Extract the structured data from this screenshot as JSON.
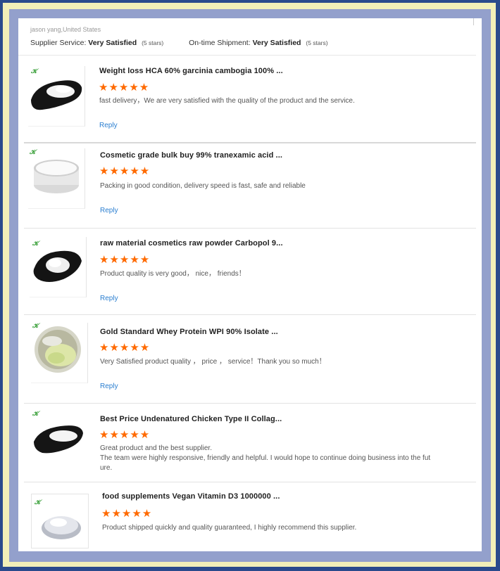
{
  "header": {
    "reviewer": "jason yang,United States",
    "supplier_service_label": "Supplier Service:",
    "supplier_service_value": "Very Satisfied",
    "supplier_service_stars": "(5 stars)",
    "shipment_label": "On-time Shipment:",
    "shipment_value": "Very Satisfied",
    "shipment_stars": "(5 stars)"
  },
  "star_glyph": "★★★★★",
  "leaf_glyph": "𝒦",
  "reviews": [
    {
      "title": "Weight loss HCA 60% garcinia cambogia 100% ...",
      "text": "fast delivery，We are very satisfied with the quality of the product and the service.",
      "reply": "Reply",
      "rating": 5
    },
    {
      "title": "Cosmetic grade bulk buy 99% tranexamic acid ...",
      "text": "Packing in good condition, delivery speed is fast, safe and reliable",
      "reply": "Reply",
      "rating": 5
    },
    {
      "title": "raw material cosmetics raw powder Carbopol 9...",
      "text": "Product quality is very good， nice， friends！",
      "reply": "Reply",
      "rating": 5
    },
    {
      "title": "Gold Standard Whey Protein WPI 90% Isolate ...",
      "text": "Very Satisfied product quality ， price ， service！Thank you so much！",
      "reply": "Reply",
      "rating": 5
    },
    {
      "title": "Best Price Undenatured Chicken Type II Collag...",
      "text": "Great product and the best supplier.\nThe team were highly responsive, friendly and helpful. I would hope to continue doing business into the fut\nure.",
      "rating": 5
    },
    {
      "title": "food supplements Vegan Vitamin D3 1000000 ...",
      "text": "Product shipped quickly and quality guaranteed, I highly recommend this supplier.",
      "rating": 5
    }
  ],
  "colors": {
    "star": "#ff6a00",
    "link": "#2a7ed0",
    "border": "#2a4a8c",
    "frame": "#f2efb8"
  }
}
